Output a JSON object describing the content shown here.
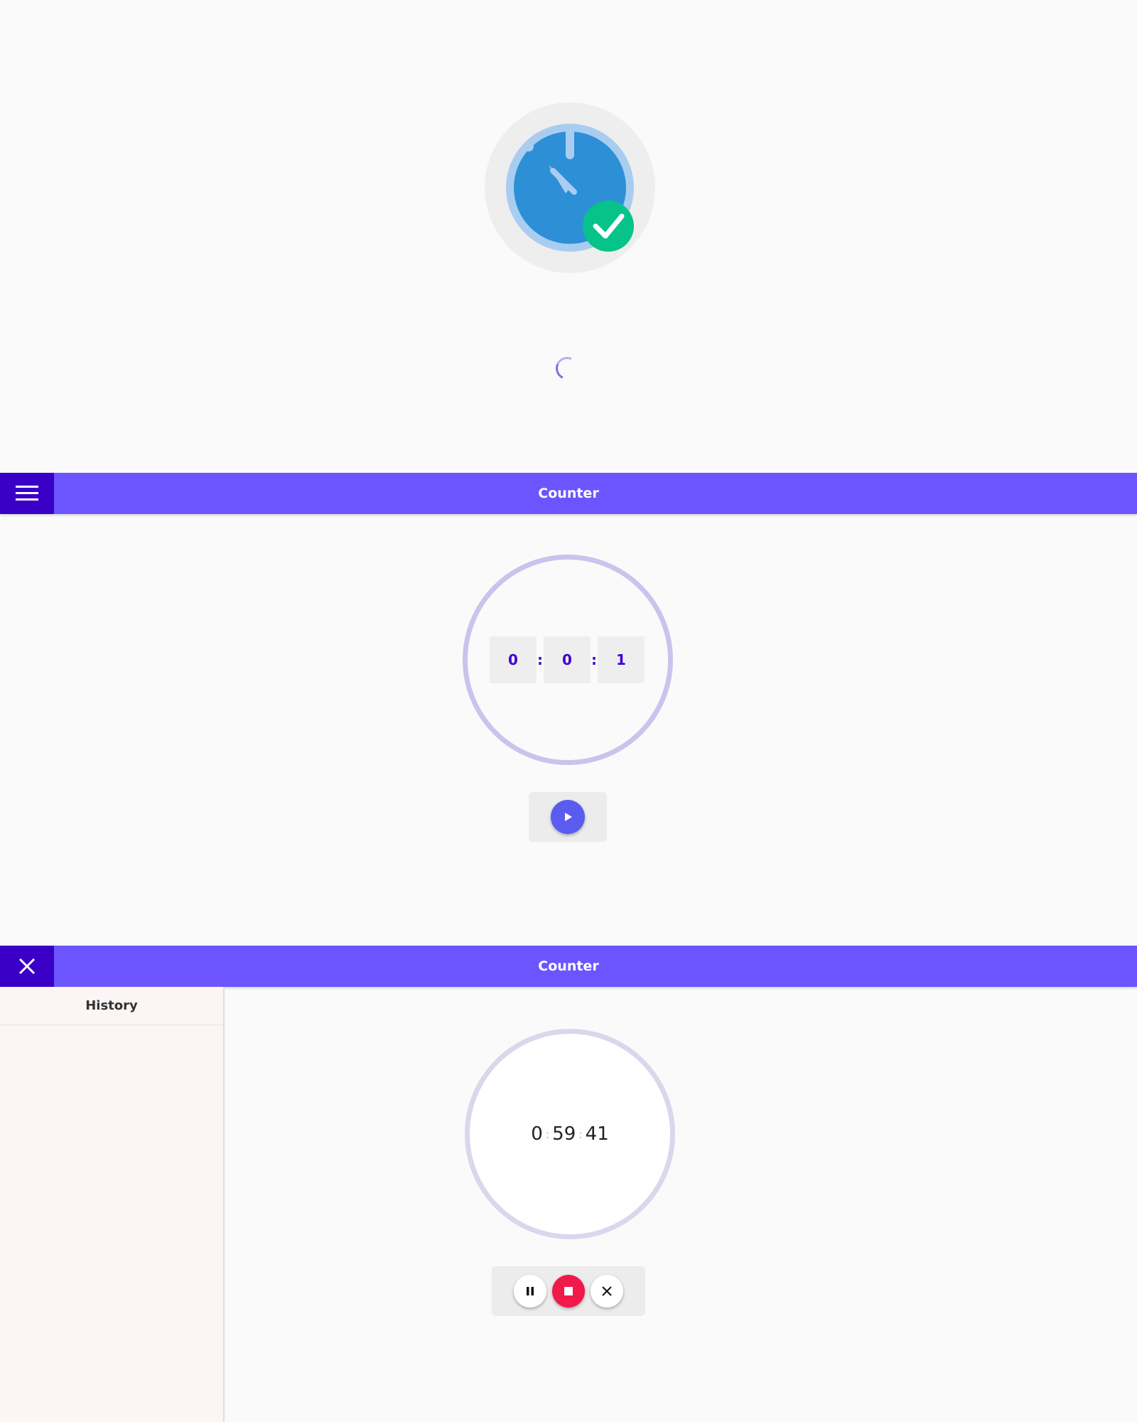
{
  "colors": {
    "appbar": "#6c55ff",
    "appbar_button": "#3b00c7",
    "digit_text": "#3f00d6",
    "play_button": "#5a5cf0",
    "stop_button": "#f0194a",
    "logo_blue": "#2d8fd6",
    "check_green": "#06c38a"
  },
  "splash": {
    "logo_icon": "stopwatch-check-icon",
    "spinner": "loading-spinner"
  },
  "counter_idle": {
    "appbar": {
      "menu_icon": "hamburger-menu-icon",
      "title": "Counter"
    },
    "digits": {
      "hours": "0",
      "minutes": "0",
      "seconds": "1",
      "separator": ":"
    },
    "play_icon": "play-icon"
  },
  "counter_running": {
    "appbar": {
      "close_icon": "close-icon",
      "title": "Counter"
    },
    "history": {
      "title": "History"
    },
    "time": {
      "hours": "0",
      "minutes": "59",
      "seconds": "41",
      "separator": ":"
    },
    "controls": {
      "pause_icon": "pause-icon",
      "stop_icon": "stop-icon",
      "cancel_icon": "close-icon"
    }
  }
}
